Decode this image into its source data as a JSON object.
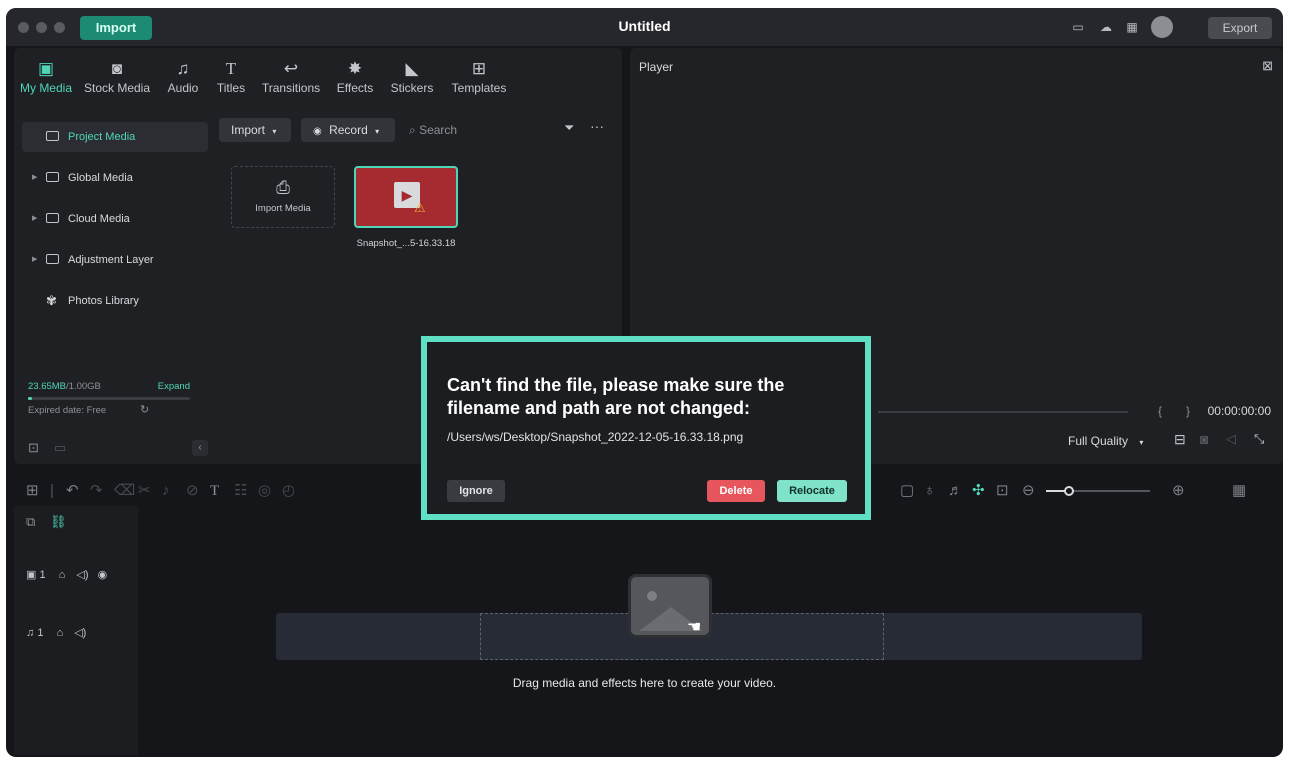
{
  "titlebar": {
    "title": "Untitled",
    "import_label": "Import",
    "export_label": "Export",
    "icons": [
      "layout-icon",
      "cloud-upload-icon",
      "grid-icon",
      "avatar"
    ]
  },
  "library": {
    "tabs": [
      {
        "label": "My Media",
        "icon": "my-media-icon",
        "active": true
      },
      {
        "label": "Stock Media",
        "icon": "stock-media-icon"
      },
      {
        "label": "Audio",
        "icon": "music-note-icon"
      },
      {
        "label": "Titles",
        "icon": "text-t-icon"
      },
      {
        "label": "Transitions",
        "icon": "transitions-icon"
      },
      {
        "label": "Effects",
        "icon": "effects-star-icon"
      },
      {
        "label": "Stickers",
        "icon": "stickers-icon"
      },
      {
        "label": "Templates",
        "icon": "templates-icon"
      }
    ],
    "sidebar": [
      {
        "label": "Project Media"
      },
      {
        "label": "Global Media"
      },
      {
        "label": "Cloud Media"
      },
      {
        "label": "Adjustment Layer"
      },
      {
        "label": "Photos Library"
      }
    ],
    "storage": {
      "used": "23.65MB",
      "total": "/1.00GB",
      "expand": "Expand",
      "expired": "Expired date: Free",
      "fill_fraction": 0.024
    },
    "toolbar": {
      "import": "Import",
      "record": "Record",
      "search_placeholder": "Search"
    },
    "import_tile_label": "Import Media",
    "clip_name": "Snapshot_...5-16.33.18"
  },
  "player": {
    "title": "Player",
    "timecode": "00:00:00:00",
    "quality": "Full Quality",
    "brace_left": "{",
    "brace_right": "}"
  },
  "timeline": {
    "tracks": [
      {
        "label": "1",
        "type": "video"
      },
      {
        "label": "1",
        "type": "audio"
      }
    ],
    "drop_text": "Drag media and effects here to create your video."
  },
  "dialog": {
    "message": "Can't find the file, please make sure the filename and path are not changed:",
    "path": "/Users/ws/Desktop/Snapshot_2022-12-05-16.33.18.png",
    "ignore": "Ignore",
    "delete": "Delete",
    "relocate": "Relocate",
    "colors": {
      "accent": "#5fe0c4",
      "delete": "#e8565d",
      "relocate": "#7ee3c9"
    }
  }
}
